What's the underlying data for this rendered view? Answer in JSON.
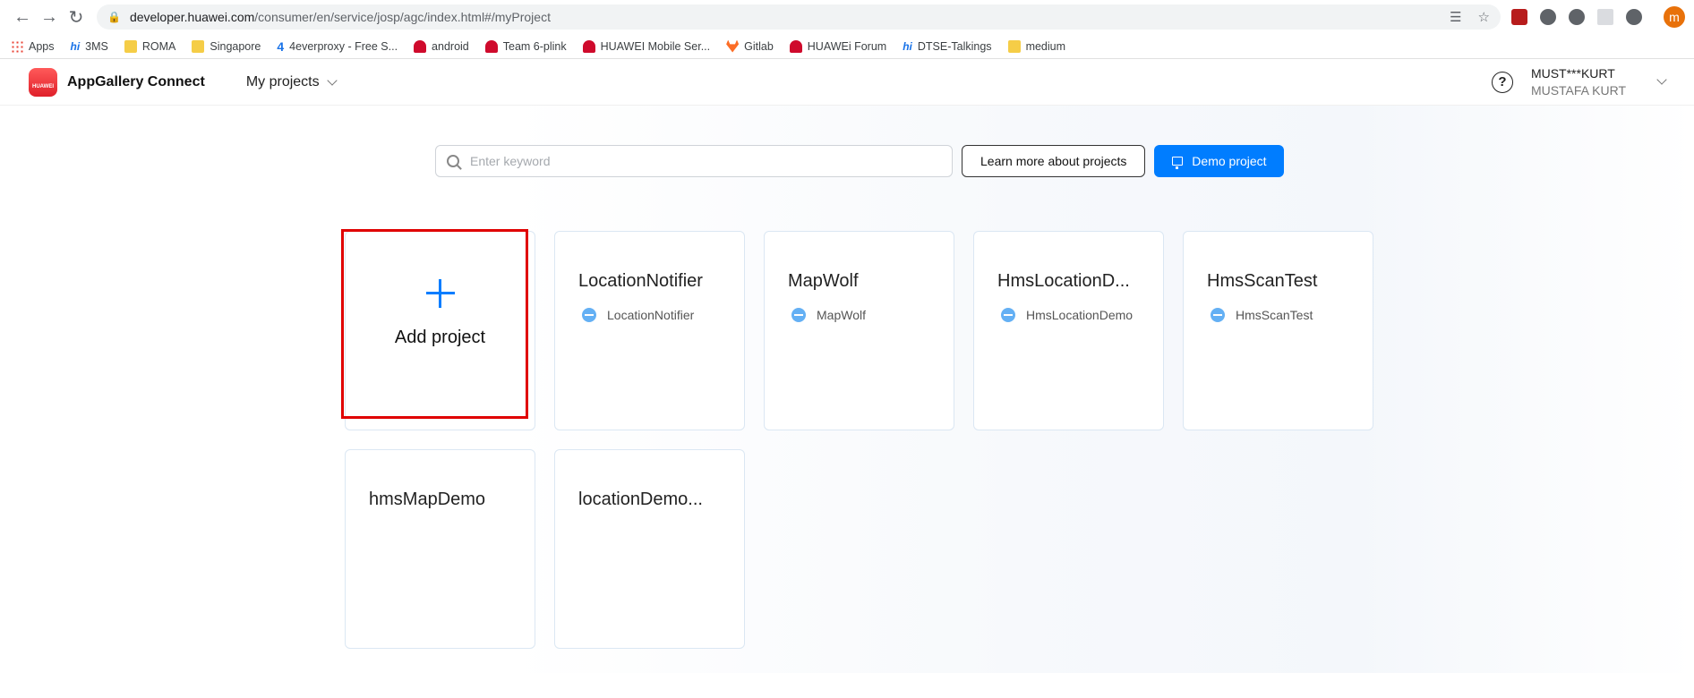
{
  "browser": {
    "url_host": "developer.huawei.com",
    "url_path": "/consumer/en/service/josp/agc/index.html#/myProject",
    "profile_initial": "m",
    "bookmarks": [
      {
        "label": "Apps",
        "icon": "apps-grid-icon"
      },
      {
        "label": "3MS",
        "icon": "hi-icon"
      },
      {
        "label": "ROMA",
        "icon": "folder-icon"
      },
      {
        "label": "Singapore",
        "icon": "folder-icon"
      },
      {
        "label": "4everproxy - Free S...",
        "icon": "four-icon"
      },
      {
        "label": "android",
        "icon": "huawei-icon"
      },
      {
        "label": "Team 6-plink",
        "icon": "huawei-icon"
      },
      {
        "label": "HUAWEI Mobile Ser...",
        "icon": "huawei-icon"
      },
      {
        "label": "Gitlab",
        "icon": "gitlab-icon"
      },
      {
        "label": "HUAWEi Forum",
        "icon": "huawei-icon"
      },
      {
        "label": "DTSE-Talkings",
        "icon": "hi-icon"
      },
      {
        "label": "medium",
        "icon": "folder-icon"
      }
    ]
  },
  "header": {
    "logo_text": "HUAWEI",
    "brand": "AppGallery Connect",
    "projects_menu": "My projects",
    "user_id": "MUST***KURT",
    "user_name": "MUSTAFA KURT"
  },
  "toolbar": {
    "search_placeholder": "Enter keyword",
    "learn_label": "Learn more about projects",
    "demo_label": "Demo project"
  },
  "add_card": {
    "label": "Add project"
  },
  "projects": [
    {
      "title": "LocationNotifier",
      "app": "LocationNotifier"
    },
    {
      "title": "MapWolf",
      "app": "MapWolf"
    },
    {
      "title": "HmsLocationD...",
      "app": "HmsLocationDemo"
    },
    {
      "title": "HmsScanTest",
      "app": "HmsScanTest"
    },
    {
      "title": "hmsMapDemo",
      "app": ""
    },
    {
      "title": "locationDemo...",
      "app": ""
    }
  ],
  "colors": {
    "accent": "#007dff",
    "highlight": "#e00000"
  }
}
